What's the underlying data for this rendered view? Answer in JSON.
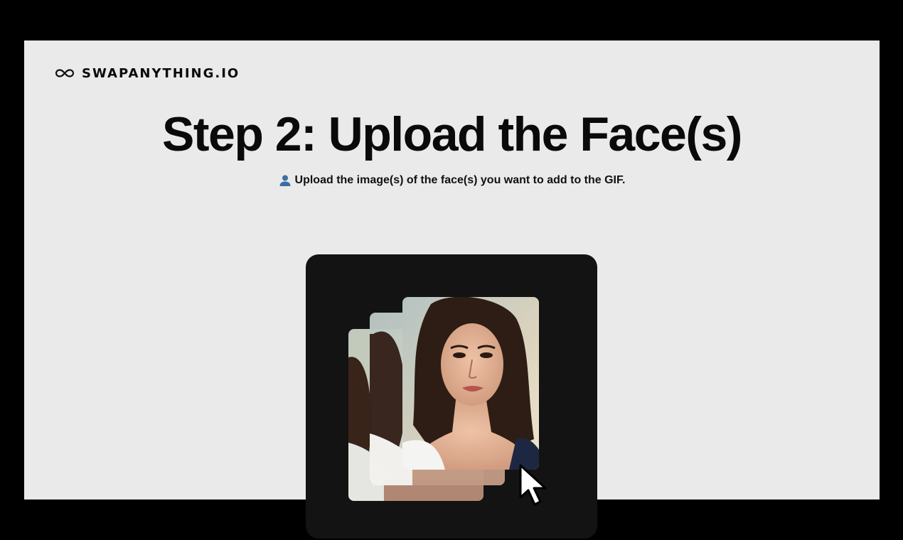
{
  "brand": {
    "name": "SWAPANYTHING.IO",
    "icon": "infinity-icon"
  },
  "page": {
    "title": "Step 2: Upload the Face(s)",
    "subtitle": "Upload the image(s) of the face(s) you want to add to the GIF.",
    "subtitle_icon": "person-icon"
  },
  "upload": {
    "icon": "cursor-arrow-icon",
    "images": [
      "face-photo-back",
      "face-photo-middle",
      "face-photo-front"
    ]
  },
  "colors": {
    "frame": "#000000",
    "slide_background": "#eaeaea",
    "card_background": "#131313",
    "text": "#0a0a0a",
    "person_icon": "#3a6ea5"
  }
}
